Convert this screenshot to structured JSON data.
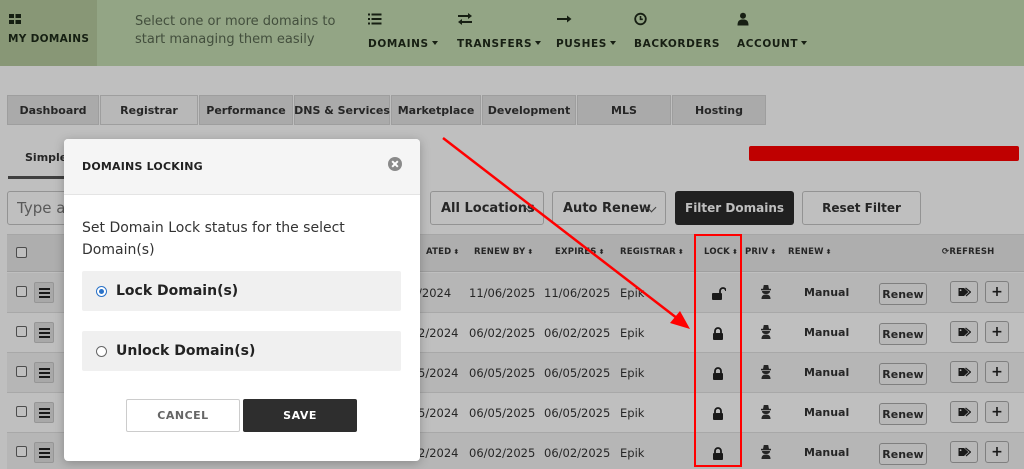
{
  "nav": {
    "brand_label": "MY DOMAINS",
    "tagline": "Select one or more domains to start managing them easily",
    "items": [
      {
        "label": "DOMAINS",
        "icon": "list-icon",
        "dropdown": true
      },
      {
        "label": "TRANSFERS",
        "icon": "transfer-arrows-icon",
        "dropdown": true
      },
      {
        "label": "PUSHES",
        "icon": "arrow-right-icon",
        "dropdown": true
      },
      {
        "label": "BACKORDERS",
        "icon": "clock-icon",
        "dropdown": false
      },
      {
        "label": "ACCOUNT",
        "icon": "user-icon",
        "dropdown": true
      }
    ]
  },
  "tabs": [
    "Dashboard",
    "Registrar",
    "Performance",
    "DNS & Services",
    "Marketplace",
    "Development",
    "MLS",
    "Hosting"
  ],
  "active_tab": "Registrar",
  "subtab": "Simple",
  "filters": {
    "search_placeholder": "Type a",
    "locations": "All Locations",
    "auto_renew": "Auto Renew",
    "filter_button": "Filter Domains",
    "reset_button": "Reset Filter"
  },
  "table": {
    "headers": {
      "created": "ATED",
      "renew_by": "RENEW BY",
      "expires": "EXPIRES",
      "registrar": "REGISTRAR",
      "lock": "LOCK",
      "priv": "PRIV",
      "renew": "RENEW",
      "refresh": "REFRESH"
    },
    "rows": [
      {
        "created": "/2024",
        "renew_by": "11/06/2025",
        "expires": "11/06/2025",
        "registrar": "Epik",
        "lock": "unlocked",
        "renew": "Manual",
        "renew_btn": "Renew"
      },
      {
        "created": "2/2024",
        "renew_by": "06/02/2025",
        "expires": "06/02/2025",
        "registrar": "Epik",
        "lock": "locked",
        "renew": "Manual",
        "renew_btn": "Renew"
      },
      {
        "created": "5/2024",
        "renew_by": "06/05/2025",
        "expires": "06/05/2025",
        "registrar": "Epik",
        "lock": "locked",
        "renew": "Manual",
        "renew_btn": "Renew"
      },
      {
        "created": "5/2024",
        "renew_by": "06/05/2025",
        "expires": "06/05/2025",
        "registrar": "Epik",
        "lock": "locked",
        "renew": "Manual",
        "renew_btn": "Renew"
      },
      {
        "created": "2/2024",
        "renew_by": "06/02/2025",
        "expires": "06/02/2025",
        "registrar": "Epik",
        "lock": "locked",
        "renew": "Manual",
        "renew_btn": "Renew"
      }
    ]
  },
  "modal": {
    "title": "DOMAINS LOCKING",
    "description": "Set Domain Lock status for the select Domain(s)",
    "option_lock": "Lock Domain(s)",
    "option_unlock": "Unlock Domain(s)",
    "selected": "lock",
    "cancel": "CANCEL",
    "save": "SAVE"
  },
  "colors": {
    "nav_bg": "#c5dcb2",
    "annotation": "#ff0000",
    "primary_dark": "#2b2b2b"
  }
}
